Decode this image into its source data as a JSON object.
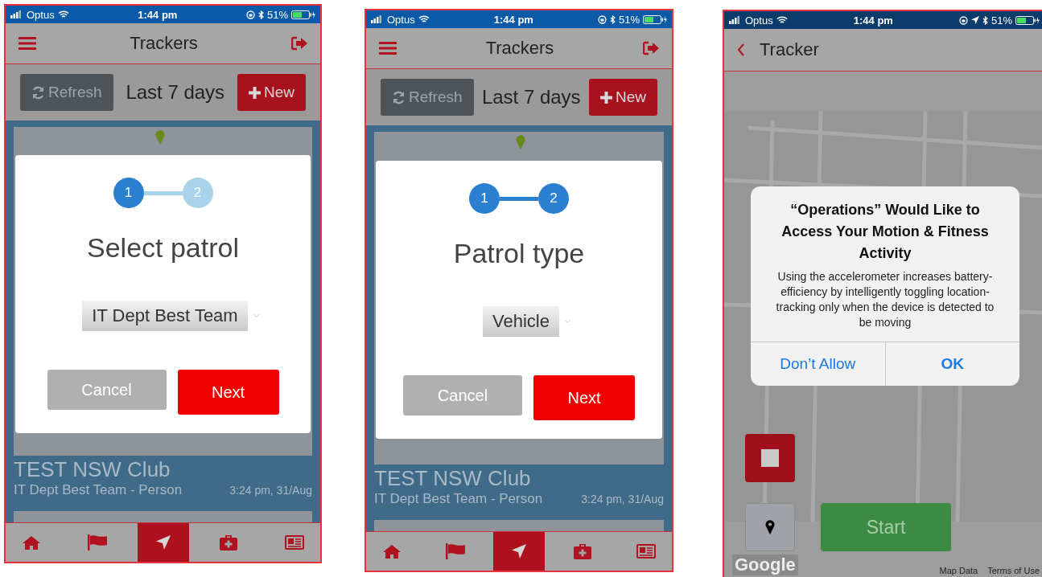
{
  "phones": [
    {
      "kind": "list",
      "status": {
        "carrier": "Optus",
        "time": "1:44 pm",
        "battery": "51%",
        "location": false
      },
      "header": {
        "title": "Trackers"
      },
      "toolbar": {
        "refresh": "Refresh",
        "range": "Last 7 days",
        "new": "New"
      },
      "card": {
        "title": "TEST NSW Club",
        "subtitle": "IT Dept Best Team - Person",
        "time": "3:24 pm, 31/Aug"
      },
      "nav": [
        {
          "selected": false
        },
        {
          "selected": false
        },
        {
          "selected": true
        },
        {
          "selected": false
        },
        {
          "selected": false
        }
      ],
      "dialog": {
        "steps": [
          {
            "label": "1",
            "active": true
          },
          {
            "label": "2",
            "active": false
          }
        ],
        "title": "Select patrol",
        "select": "IT Dept Best Team",
        "cancel": "Cancel",
        "next": "Next"
      }
    },
    {
      "kind": "list",
      "status": {
        "carrier": "Optus",
        "time": "1:44 pm",
        "battery": "51%",
        "location": false
      },
      "header": {
        "title": "Trackers"
      },
      "toolbar": {
        "refresh": "Refresh",
        "range": "Last 7 days",
        "new": "New"
      },
      "card": {
        "title": "TEST NSW Club",
        "subtitle": "IT Dept Best Team - Person",
        "time": "3:24 pm, 31/Aug"
      },
      "nav": [
        {
          "selected": false
        },
        {
          "selected": false
        },
        {
          "selected": true
        },
        {
          "selected": false
        },
        {
          "selected": false
        }
      ],
      "dialog": {
        "steps": [
          {
            "label": "1",
            "active": true
          },
          {
            "label": "2",
            "active": true
          }
        ],
        "title": "Patrol type",
        "select": "Vehicle",
        "cancel": "Cancel",
        "next": "Next"
      }
    },
    {
      "kind": "tracker",
      "status": {
        "carrier": "Optus",
        "time": "1:44 pm",
        "battery": "51%",
        "location": true
      },
      "header": {
        "title": "Tracker"
      },
      "alert": {
        "title": "“Operations” Would Like to Access Your Motion & Fitness Activity",
        "message": "Using the accelerometer increases battery-efficiency by intelligently toggling location-tracking only when the device is detected to be moving",
        "buttons": [
          {
            "label": "Don’t Allow",
            "bold": false
          },
          {
            "label": "OK",
            "bold": true
          }
        ]
      },
      "start": "Start",
      "map_logo": "Google",
      "map_links": [
        "Map Data",
        "Terms of Use"
      ]
    }
  ]
}
